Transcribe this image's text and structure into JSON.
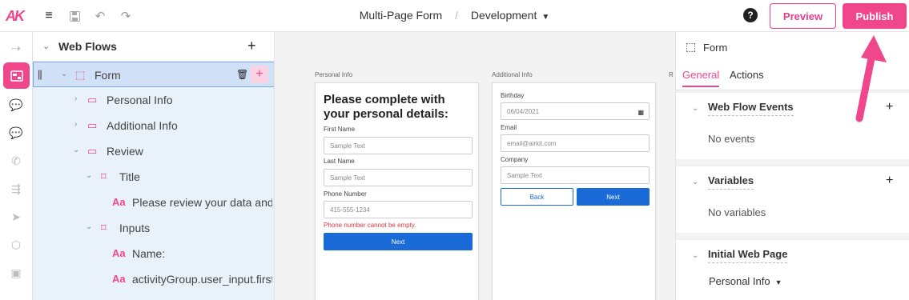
{
  "topbar": {
    "logo": "AK",
    "breadcrumb_name": "Multi-Page Form",
    "breadcrumb_sep": "/",
    "environment": "Development",
    "preview_label": "Preview",
    "publish_label": "Publish",
    "help_symbol": "?"
  },
  "tree": {
    "header": "Web Flows",
    "rows": [
      {
        "label": "Form",
        "selected": true
      },
      {
        "label": "Personal Info"
      },
      {
        "label": "Additional Info"
      },
      {
        "label": "Review"
      },
      {
        "label": "Title"
      },
      {
        "label": "Please review your data and"
      },
      {
        "label": "Inputs"
      },
      {
        "label": "Name:"
      },
      {
        "label": "activityGroup.user_input.first_"
      }
    ],
    "text_icon": "Aa"
  },
  "canvas": {
    "pages": [
      {
        "label": "Personal Info",
        "heading": "Please complete with your personal details:",
        "fields": [
          {
            "label": "First Name",
            "placeholder": "Sample Text"
          },
          {
            "label": "Last Name",
            "placeholder": "Sample Text"
          },
          {
            "label": "Phone Number",
            "placeholder": "415-555-1234"
          }
        ],
        "error": "Phone number cannot be empty.",
        "next": "Next"
      },
      {
        "label": "Additional Info",
        "fields": [
          {
            "label": "Birthday",
            "placeholder": "06/04/2021"
          },
          {
            "label": "Email",
            "placeholder": "email@airkit.com"
          },
          {
            "label": "Company",
            "placeholder": "Sample Text"
          }
        ],
        "back": "Back",
        "next": "Next"
      },
      {
        "label": "R"
      }
    ]
  },
  "inspector": {
    "title": "Form",
    "tabs": [
      "General",
      "Actions"
    ],
    "sections": [
      {
        "title": "Web Flow Events",
        "empty": "No events"
      },
      {
        "title": "Variables",
        "empty": "No variables"
      },
      {
        "title": "Initial Web Page",
        "value": "Personal Info"
      }
    ]
  },
  "colors": {
    "accent": "#f0468c",
    "primary_button": "#1a6ad8",
    "tree_bg": "#e9f1fb"
  }
}
